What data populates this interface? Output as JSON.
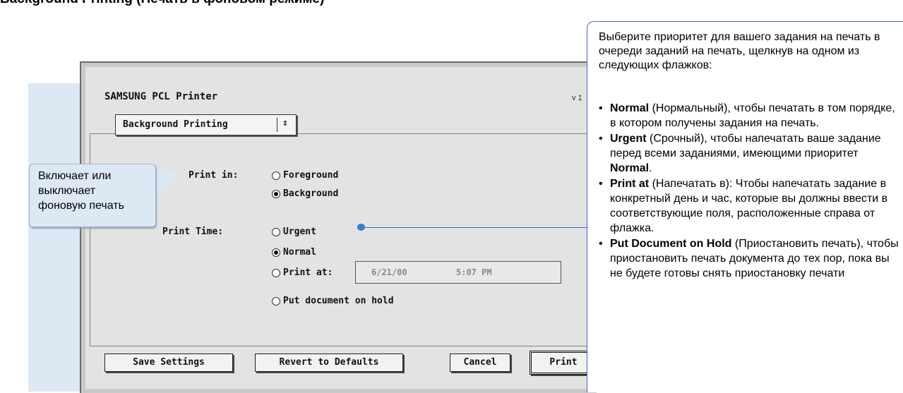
{
  "page": {
    "heading": "Background Printing (Печать в фоновом режиме)"
  },
  "dialog": {
    "printer_title": "SAMSUNG PCL Printer",
    "version": "v 1",
    "popup": {
      "label": "Background Printing",
      "arrow": "⇕"
    },
    "print_in": {
      "label": "Print in:",
      "options": [
        {
          "label": "Foreground",
          "selected": false
        },
        {
          "label": "Background",
          "selected": true
        }
      ]
    },
    "print_time": {
      "label": "Print Time:",
      "options": [
        {
          "label": "Urgent",
          "selected": false
        },
        {
          "label": "Normal",
          "selected": true
        },
        {
          "label": "Print at:",
          "selected": false
        },
        {
          "label": "Put document on hold",
          "selected": false
        }
      ],
      "date": "6/21/00",
      "time": "5:07 PM"
    },
    "buttons": {
      "save": "Save Settings",
      "revert": "Revert to Defaults",
      "cancel": "Cancel",
      "print": "Print"
    }
  },
  "callout_left": {
    "text": "Включает или\nвыключает\nфоновую печать"
  },
  "callout_right": {
    "intro": "Выберите приоритет для вашего задания на печать в очереди заданий на печать, щелкнув на одном из следующих флажков:",
    "items": [
      {
        "term": "Normal",
        "before": "",
        "desc": " (Нормальный), чтобы печатать в том порядке, в котором получены задания на печать."
      },
      {
        "term": "Urgent",
        "desc": " (Срочный), чтобы напечатать ваше задание перед всеми заданиями, имеющими приоритет ",
        "term2": "Normal",
        "tail": "."
      },
      {
        "term": "Print at",
        "desc": " (Напечатать в): Чтобы напечатать задание в конкретный день и час, которые вы должны ввести в соответствующие поля, расположенные справа от флажка."
      },
      {
        "term": "Put Document on Hold",
        "desc": " (Приостановить печать), чтобы приостановить печать документа до тех пор, пока вы не будете готовы снять приостановку печати"
      }
    ]
  },
  "colors": {
    "callout_fill": "#dde8f5",
    "connector": "#3a6bc6"
  }
}
